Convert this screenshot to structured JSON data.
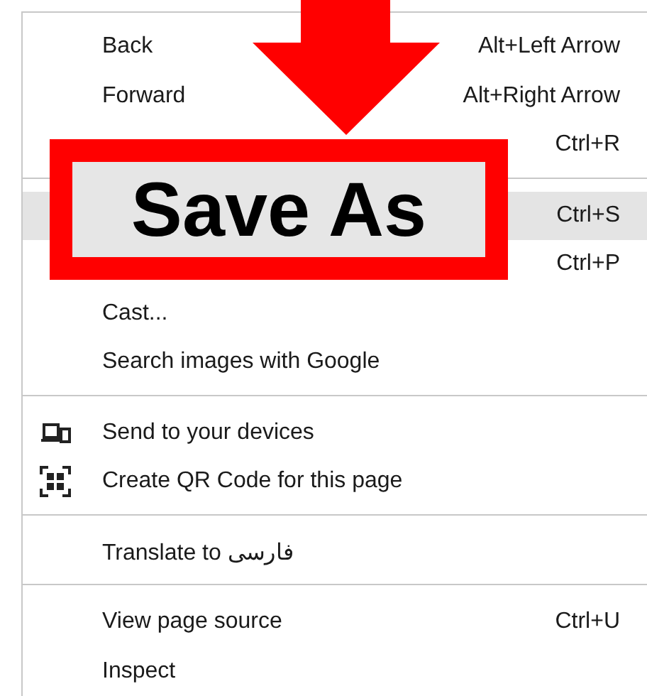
{
  "menu": {
    "groups": [
      [
        {
          "label": "Back",
          "shortcut": "Alt+Left Arrow",
          "selected": false
        },
        {
          "label": "Forward",
          "shortcut": "Alt+Right Arrow",
          "selected": false
        },
        {
          "shortcut": "Ctrl+R",
          "selected": false
        }
      ],
      [
        {
          "shortcut": "Ctrl+S",
          "selected": true
        },
        {
          "shortcut": "Ctrl+P",
          "selected": false
        },
        {
          "label": "Cast...",
          "selected": false
        },
        {
          "label": "Search images with Google",
          "selected": false
        }
      ],
      [
        {
          "label": "Send to your devices",
          "kind": "devices",
          "selected": false
        },
        {
          "label": "Create QR Code for this page",
          "kind": "qr",
          "selected": false
        }
      ],
      [
        {
          "label": "Translate to فارسی",
          "selected": false
        }
      ],
      [
        {
          "label": "View page source",
          "shortcut": "Ctrl+U",
          "selected": false
        },
        {
          "label": "Inspect",
          "selected": false
        }
      ]
    ]
  },
  "callout": {
    "label": "Save As"
  }
}
